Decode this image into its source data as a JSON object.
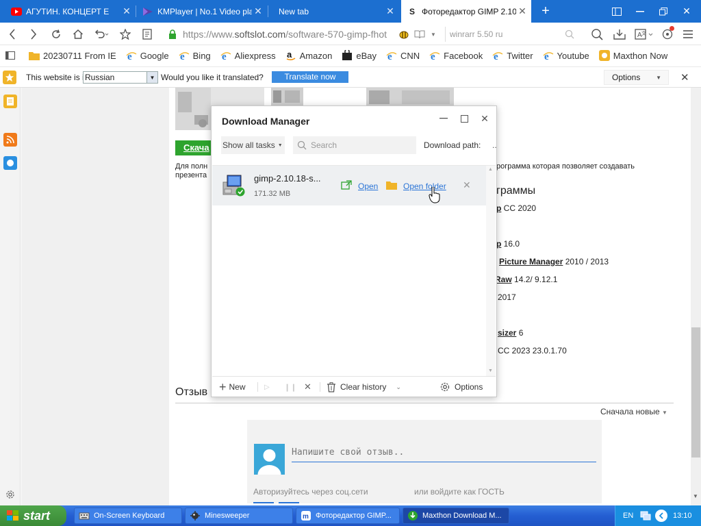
{
  "tabs": [
    {
      "label": "АГУТИН. КОНЦЕРТ Е",
      "icon": "youtube-icon"
    },
    {
      "label": "KMPlayer | No.1 Video play",
      "icon": "kmplayer-icon"
    },
    {
      "label": "New tab",
      "icon": ""
    },
    {
      "label": "Фоторедактор GIMP 2.10.",
      "icon": "softslot-icon"
    }
  ],
  "nav": {
    "url_prefix": "https://www.",
    "url_host": "softslot.com",
    "url_path": "/software-570-gimp-fhot",
    "search_placeholder": "winrarr 5.50 ru"
  },
  "bookmarks": [
    {
      "label": "20230711 From IE",
      "icon": "folder-icon"
    },
    {
      "label": "Google",
      "icon": "ie-icon"
    },
    {
      "label": "Bing",
      "icon": "ie-icon"
    },
    {
      "label": "Aliexpress",
      "icon": "ie-icon"
    },
    {
      "label": "Amazon",
      "icon": "amazon-icon"
    },
    {
      "label": "eBay",
      "icon": "ebay-icon"
    },
    {
      "label": "CNN",
      "icon": "ie-icon"
    },
    {
      "label": "Facebook",
      "icon": "ie-icon"
    },
    {
      "label": "Twitter",
      "icon": "ie-icon"
    },
    {
      "label": "Youtube",
      "icon": "ie-icon"
    },
    {
      "label": "Maxthon Now",
      "icon": "maxthon-icon"
    }
  ],
  "translate": {
    "prefix": "This website is in",
    "language": "Russian",
    "question": "Would you like it translated?",
    "button": "Translate now",
    "options": "Options"
  },
  "page": {
    "download_btn": "Скача",
    "desc_line1_left": "Для полн",
    "desc_line2_left": "презента",
    "desc_line1_right": "рограмма которая позволяет создавать",
    "heading_right": "граммы",
    "items": [
      {
        "bold": "p",
        "rest": " CC 2020"
      },
      {
        "bold": "p",
        "rest": " 16.0"
      },
      {
        "bold": "Picture Manager",
        "rest": " 2010 / 2013"
      },
      {
        "bold": "Raw",
        "rest": " 14.2/ 9.12.1"
      },
      {
        "bold": "",
        "rest": "2017"
      },
      {
        "bold": "sizer",
        "rest": " 6"
      },
      {
        "bold": "",
        "rest": "CC 2023 23.0.1.70"
      }
    ],
    "reviews_heading": "Отзыв",
    "sort": "Сначала новые",
    "comment_placeholder": "Напишите свой отзыв..",
    "auth_social": "Авторизуйтесь через соц.сети",
    "auth_guest": "или войдите как ГОСТЬ"
  },
  "download_manager": {
    "title": "Download Manager",
    "filter": "Show all tasks",
    "search_placeholder": "Search",
    "path_label": "Download path:",
    "path_dots": "..",
    "file_name": "gimp-2.10.18-s...",
    "file_size": "171.32 MB",
    "open": "Open",
    "open_folder": "Open folder",
    "new": "New",
    "clear_history": "Clear history",
    "options": "Options"
  },
  "taskbar": {
    "start": "start",
    "tasks": [
      {
        "label": "On-Screen Keyboard",
        "active": false
      },
      {
        "label": "Minesweeper",
        "active": false
      },
      {
        "label": "Фоторедактор GIMP...",
        "active": false
      },
      {
        "label": "Maxthon Download M...",
        "active": true
      }
    ],
    "lang": "EN",
    "time": "13:10"
  },
  "colors": {
    "tab_bar": "#1c6fd0",
    "link": "#2a74d6",
    "translate_button": "#3b8be0",
    "download_green": "#2ea42e",
    "taskbar": "#245ed2"
  }
}
